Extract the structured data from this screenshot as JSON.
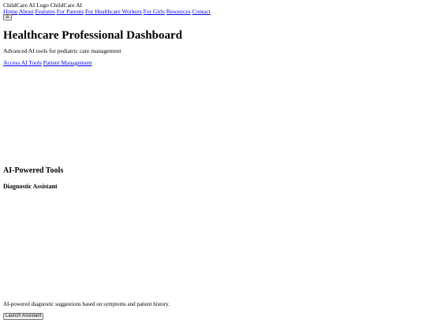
{
  "header": {
    "logo_alt": "ChildCare AI Logo",
    "brand_name": "ChildCare AI",
    "nav": [
      {
        "label": "Home"
      },
      {
        "label": "About"
      },
      {
        "label": "Features"
      },
      {
        "label": "For Parents"
      },
      {
        "label": "For Healthcare Workers"
      },
      {
        "label": "For Girls"
      },
      {
        "label": "Resources"
      },
      {
        "label": "Contact"
      }
    ],
    "menu_toggle_glyph": "☰",
    "menu_icon": "hamburger-menu-icon"
  },
  "hero": {
    "title": "Healthcare Professional Dashboard",
    "subtitle": "Advanced AI tools for pediatric care management",
    "links": [
      {
        "label": "Access AI Tools"
      },
      {
        "label": "Patient Management"
      }
    ]
  },
  "tools": {
    "section_title": "AI-Powered Tools",
    "card": {
      "title": "Diagnostic Assistant",
      "description": "AI-powered diagnostic suggestions based on symptoms and patient history.",
      "button_label": "Launch Assistant"
    }
  }
}
